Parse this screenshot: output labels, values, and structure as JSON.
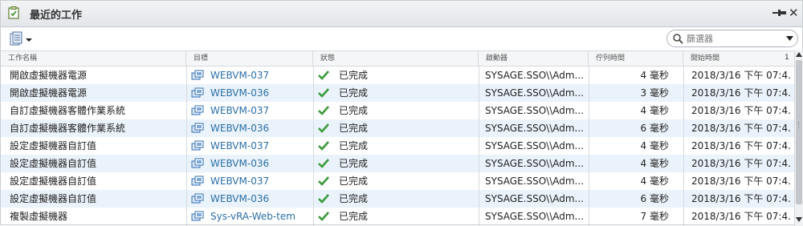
{
  "panel": {
    "title": "最近的工作"
  },
  "search": {
    "placeholder": "篩選器"
  },
  "columns": {
    "name": "工作名稱",
    "target": "目標",
    "status": "狀態",
    "initiator": "啟動器",
    "queued": "佇列時間",
    "start": "開始時間",
    "sort_indicator": "1"
  },
  "tasks": [
    {
      "name": "開啟虛擬機器電源",
      "target": "WEBVM-037",
      "status": "已完成",
      "initiator": "SYSAGE.SSO\\\\Adm...",
      "queued": "4 毫秒",
      "start": "2018/3/16 下午 07:4..."
    },
    {
      "name": "開啟虛擬機器電源",
      "target": "WEBVM-036",
      "status": "已完成",
      "initiator": "SYSAGE.SSO\\\\Adm...",
      "queued": "3 毫秒",
      "start": "2018/3/16 下午 07:4..."
    },
    {
      "name": "自訂虛擬機器客體作業系統",
      "target": "WEBVM-037",
      "status": "已完成",
      "initiator": "SYSAGE.SSO\\\\Adm...",
      "queued": "4 毫秒",
      "start": "2018/3/16 下午 07:4..."
    },
    {
      "name": "自訂虛擬機器客體作業系統",
      "target": "WEBVM-036",
      "status": "已完成",
      "initiator": "SYSAGE.SSO\\\\Adm...",
      "queued": "6 毫秒",
      "start": "2018/3/16 下午 07:4..."
    },
    {
      "name": "設定虛擬機器自訂值",
      "target": "WEBVM-037",
      "status": "已完成",
      "initiator": "SYSAGE.SSO\\\\Adm...",
      "queued": "4 毫秒",
      "start": "2018/3/16 下午 07:4..."
    },
    {
      "name": "設定虛擬機器自訂值",
      "target": "WEBVM-036",
      "status": "已完成",
      "initiator": "SYSAGE.SSO\\\\Adm...",
      "queued": "4 毫秒",
      "start": "2018/3/16 下午 07:4..."
    },
    {
      "name": "設定虛擬機器自訂值",
      "target": "WEBVM-037",
      "status": "已完成",
      "initiator": "SYSAGE.SSO\\\\Adm...",
      "queued": "4 毫秒",
      "start": "2018/3/16 下午 07:4..."
    },
    {
      "name": "設定虛擬機器自訂值",
      "target": "WEBVM-036",
      "status": "已完成",
      "initiator": "SYSAGE.SSO\\\\Adm...",
      "queued": "6 毫秒",
      "start": "2018/3/16 下午 07:4..."
    },
    {
      "name": "複製虛擬機器",
      "target": "Sys-vRA-Web-tem",
      "status": "已完成",
      "initiator": "SYSAGE.SSO\\\\Adm...",
      "queued": "7 毫秒",
      "start": "2018/3/16 下午 07:4..."
    }
  ],
  "icons": {
    "panel": "clipboard-check-icon",
    "export": "export-icon",
    "search": "search-icon",
    "vm": "virtual-machine-icon",
    "status": "checkmark-icon",
    "pin": "pin-icon",
    "close": "close-icon"
  },
  "colors": {
    "link": "#2b6ea8",
    "success": "#3a9a3a",
    "row_alt": "#eaf3fb"
  }
}
